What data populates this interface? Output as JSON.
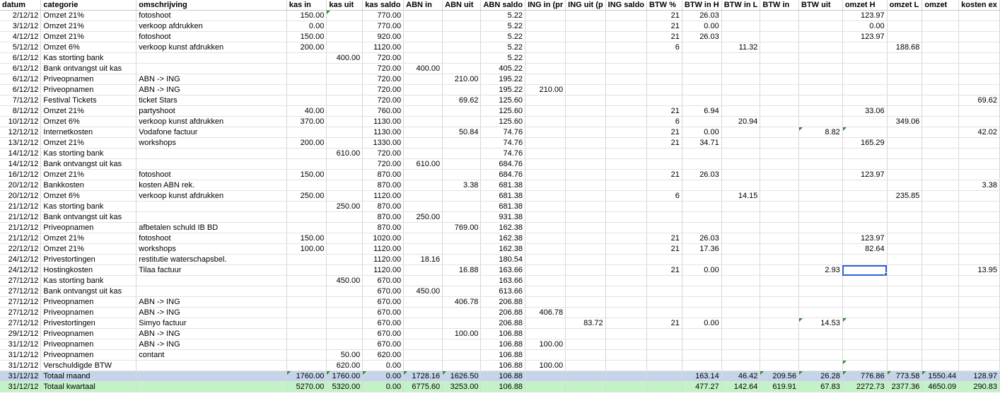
{
  "columns": [
    "datum",
    "categorie",
    "omschrijving",
    "kas in",
    "kas uit",
    "kas saldo",
    "ABN in",
    "ABN uit",
    "ABN saldo",
    "ING in (pr",
    "ING uit (p",
    "ING saldo",
    "BTW %",
    "BTW in H",
    "BTW in L",
    "BTW in",
    "BTW uit",
    "omzet H",
    "omzet L",
    "omzet",
    "kosten ex"
  ],
  "rows": [
    [
      "2/12/12",
      "Omzet 21%",
      "fotoshoot",
      "150.00",
      "",
      "770.00",
      "",
      "",
      "5.22",
      "",
      "",
      "",
      "21",
      "26.03",
      "",
      "",
      "",
      "123.97",
      "",
      "",
      ""
    ],
    [
      "3/12/12",
      "Omzet 21%",
      "verkoop afdrukken",
      "0.00",
      "",
      "770.00",
      "",
      "",
      "5.22",
      "",
      "",
      "",
      "21",
      "0.00",
      "",
      "",
      "",
      "0.00",
      "",
      "",
      ""
    ],
    [
      "4/12/12",
      "Omzet 21%",
      "fotoshoot",
      "150.00",
      "",
      "920.00",
      "",
      "",
      "5.22",
      "",
      "",
      "",
      "21",
      "26.03",
      "",
      "",
      "",
      "123.97",
      "",
      "",
      ""
    ],
    [
      "5/12/12",
      "Omzet 6%",
      "verkoop kunst afdrukken",
      "200.00",
      "",
      "1120.00",
      "",
      "",
      "5.22",
      "",
      "",
      "",
      "6",
      "",
      "11.32",
      "",
      "",
      "",
      "188.68",
      "",
      ""
    ],
    [
      "6/12/12",
      "Kas storting bank",
      "",
      "",
      "400.00",
      "720.00",
      "",
      "",
      "5.22",
      "",
      "",
      "",
      "",
      "",
      "",
      "",
      "",
      "",
      "",
      "",
      ""
    ],
    [
      "6/12/12",
      "Bank ontvangst uit kas",
      "",
      "",
      "",
      "720.00",
      "400.00",
      "",
      "405.22",
      "",
      "",
      "",
      "",
      "",
      "",
      "",
      "",
      "",
      "",
      "",
      ""
    ],
    [
      "6/12/12",
      "Priveopnamen",
      "ABN -> ING",
      "",
      "",
      "720.00",
      "",
      "210.00",
      "195.22",
      "",
      "",
      "",
      "",
      "",
      "",
      "",
      "",
      "",
      "",
      "",
      ""
    ],
    [
      "6/12/12",
      "Priveopnamen",
      "ABN -> ING",
      "",
      "",
      "720.00",
      "",
      "",
      "195.22",
      "210.00",
      "",
      "",
      "",
      "",
      "",
      "",
      "",
      "",
      "",
      "",
      ""
    ],
    [
      "7/12/12",
      "Festival Tickets",
      "ticket Stars",
      "",
      "",
      "720.00",
      "",
      "69.62",
      "125.60",
      "",
      "",
      "",
      "",
      "",
      "",
      "",
      "",
      "",
      "",
      "",
      "69.62"
    ],
    [
      "8/12/12",
      "Omzet 21%",
      "partyshoot",
      "40.00",
      "",
      "760.00",
      "",
      "",
      "125.60",
      "",
      "",
      "",
      "21",
      "6.94",
      "",
      "",
      "",
      "33.06",
      "",
      "",
      ""
    ],
    [
      "10/12/12",
      "Omzet 6%",
      "verkoop kunst afdrukken",
      "370.00",
      "",
      "1130.00",
      "",
      "",
      "125.60",
      "",
      "",
      "",
      "6",
      "",
      "20.94",
      "",
      "",
      "",
      "349.06",
      "",
      ""
    ],
    [
      "12/12/12",
      "Internetkosten",
      "Vodafone factuur",
      "",
      "",
      "1130.00",
      "",
      "50.84",
      "74.76",
      "",
      "",
      "",
      "21",
      "0.00",
      "",
      "",
      "8.82",
      "",
      "",
      "",
      "42.02"
    ],
    [
      "13/12/12",
      "Omzet 21%",
      "workshops",
      "200.00",
      "",
      "1330.00",
      "",
      "",
      "74.76",
      "",
      "",
      "",
      "21",
      "34.71",
      "",
      "",
      "",
      "165.29",
      "",
      "",
      ""
    ],
    [
      "14/12/12",
      "Kas storting bank",
      "",
      "",
      "610.00",
      "720.00",
      "",
      "",
      "74.76",
      "",
      "",
      "",
      "",
      "",
      "",
      "",
      "",
      "",
      "",
      "",
      ""
    ],
    [
      "14/12/12",
      "Bank ontvangst uit kas",
      "",
      "",
      "",
      "720.00",
      "610.00",
      "",
      "684.76",
      "",
      "",
      "",
      "",
      "",
      "",
      "",
      "",
      "",
      "",
      "",
      ""
    ],
    [
      "16/12/12",
      "Omzet 21%",
      "fotoshoot",
      "150.00",
      "",
      "870.00",
      "",
      "",
      "684.76",
      "",
      "",
      "",
      "21",
      "26.03",
      "",
      "",
      "",
      "123.97",
      "",
      "",
      ""
    ],
    [
      "20/12/12",
      "Bankkosten",
      "kosten ABN rek.",
      "",
      "",
      "870.00",
      "",
      "3.38",
      "681.38",
      "",
      "",
      "",
      "",
      "",
      "",
      "",
      "",
      "",
      "",
      "",
      "3.38"
    ],
    [
      "20/12/12",
      "Omzet 6%",
      "verkoop kunst afdrukken",
      "250.00",
      "",
      "1120.00",
      "",
      "",
      "681.38",
      "",
      "",
      "",
      "6",
      "",
      "14.15",
      "",
      "",
      "",
      "235.85",
      "",
      ""
    ],
    [
      "21/12/12",
      "Kas storting bank",
      "",
      "",
      "250.00",
      "870.00",
      "",
      "",
      "681.38",
      "",
      "",
      "",
      "",
      "",
      "",
      "",
      "",
      "",
      "",
      "",
      ""
    ],
    [
      "21/12/12",
      "Bank ontvangst uit kas",
      "",
      "",
      "",
      "870.00",
      "250.00",
      "",
      "931.38",
      "",
      "",
      "",
      "",
      "",
      "",
      "",
      "",
      "",
      "",
      "",
      ""
    ],
    [
      "21/12/12",
      "Priveopnamen",
      "afbetalen schuld IB BD",
      "",
      "",
      "870.00",
      "",
      "769.00",
      "162.38",
      "",
      "",
      "",
      "",
      "",
      "",
      "",
      "",
      "",
      "",
      "",
      ""
    ],
    [
      "21/12/12",
      "Omzet 21%",
      "fotoshoot",
      "150.00",
      "",
      "1020.00",
      "",
      "",
      "162.38",
      "",
      "",
      "",
      "21",
      "26.03",
      "",
      "",
      "",
      "123.97",
      "",
      "",
      ""
    ],
    [
      "22/12/12",
      "Omzet 21%",
      "workshops",
      "100.00",
      "",
      "1120.00",
      "",
      "",
      "162.38",
      "",
      "",
      "",
      "21",
      "17.36",
      "",
      "",
      "",
      "82.64",
      "",
      "",
      ""
    ],
    [
      "24/12/12",
      "Privestortingen",
      "restitutie waterschapsbel.",
      "",
      "",
      "1120.00",
      "18.16",
      "",
      "180.54",
      "",
      "",
      "",
      "",
      "",
      "",
      "",
      "",
      "",
      "",
      "",
      ""
    ],
    [
      "24/12/12",
      "Hostingkosten",
      "Tilaa factuur",
      "",
      "",
      "1120.00",
      "",
      "16.88",
      "163.66",
      "",
      "",
      "",
      "21",
      "0.00",
      "",
      "",
      "2.93",
      "",
      "",
      "",
      "13.95"
    ],
    [
      "27/12/12",
      "Kas storting bank",
      "",
      "",
      "450.00",
      "670.00",
      "",
      "",
      "163.66",
      "",
      "",
      "",
      "",
      "",
      "",
      "",
      "",
      "",
      "",
      "",
      ""
    ],
    [
      "27/12/12",
      "Bank ontvangst uit kas",
      "",
      "",
      "",
      "670.00",
      "450.00",
      "",
      "613.66",
      "",
      "",
      "",
      "",
      "",
      "",
      "",
      "",
      "",
      "",
      "",
      ""
    ],
    [
      "27/12/12",
      "Priveopnamen",
      "ABN -> ING",
      "",
      "",
      "670.00",
      "",
      "406.78",
      "206.88",
      "",
      "",
      "",
      "",
      "",
      "",
      "",
      "",
      "",
      "",
      "",
      ""
    ],
    [
      "27/12/12",
      "Priveopnamen",
      "ABN -> ING",
      "",
      "",
      "670.00",
      "",
      "",
      "206.88",
      "406.78",
      "",
      "",
      "",
      "",
      "",
      "",
      "",
      "",
      "",
      "",
      ""
    ],
    [
      "27/12/12",
      "Privestortingen",
      "Simyo factuur",
      "",
      "",
      "670.00",
      "",
      "",
      "206.88",
      "",
      "83.72",
      "",
      "21",
      "0.00",
      "",
      "",
      "14.53",
      "",
      "",
      "",
      ""
    ],
    [
      "29/12/12",
      "Priveopnamen",
      "ABN -> ING",
      "",
      "",
      "670.00",
      "",
      "100.00",
      "106.88",
      "",
      "",
      "",
      "",
      "",
      "",
      "",
      "",
      "",
      "",
      "",
      ""
    ],
    [
      "31/12/12",
      "Priveopnamen",
      "ABN -> ING",
      "",
      "",
      "670.00",
      "",
      "",
      "106.88",
      "100.00",
      "",
      "",
      "",
      "",
      "",
      "",
      "",
      "",
      "",
      "",
      ""
    ],
    [
      "31/12/12",
      "Priveopnamen",
      "contant",
      "",
      "50.00",
      "620.00",
      "",
      "",
      "106.88",
      "",
      "",
      "",
      "",
      "",
      "",
      "",
      "",
      "",
      "",
      "",
      ""
    ],
    [
      "31/12/12",
      "Verschuldigde BTW",
      "",
      "",
      "620.00",
      "0.00",
      "",
      "",
      "106.88",
      "100.00",
      "",
      "",
      "",
      "",
      "",
      "",
      "",
      "",
      "",
      "",
      ""
    ]
  ],
  "totals": [
    [
      "31/12/12",
      "Totaal maand",
      "",
      "1760.00",
      "1760.00",
      "0.00",
      "1728.16",
      "1626.50",
      "106.88",
      "",
      "",
      "",
      "",
      "163.14",
      "46.42",
      "209.56",
      "26.28",
      "776.86",
      "773.58",
      "1550.44",
      "128.97"
    ],
    [
      "31/12/12",
      "Totaal kwartaal",
      "",
      "5270.00",
      "5320.00",
      "0.00",
      "6775.60",
      "3253.00",
      "106.88",
      "",
      "",
      "",
      "",
      "477.27",
      "142.64",
      "619.91",
      "67.83",
      "2272.73",
      "2377.36",
      "4650.09",
      "290.83"
    ]
  ],
  "colors": {
    "selection": "#2a62d8",
    "total_month_bg": "#c4d5ea",
    "total_quarter_bg": "#c3f2c6",
    "comment_marker": "#2f8a2f"
  }
}
